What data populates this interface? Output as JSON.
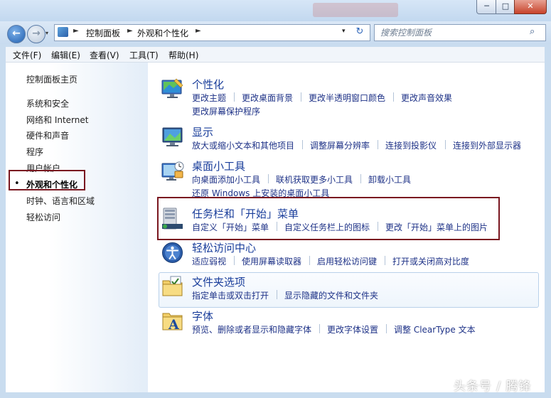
{
  "window": {
    "min_label": "─",
    "max_label": "□",
    "close_label": "✕"
  },
  "nav": {
    "back_icon": "arrow-left",
    "forward_icon": "arrow-right",
    "dropdown_glyph": "▾",
    "refresh_glyph": "↻"
  },
  "address": {
    "segments": [
      "控制面板",
      "外观和个性化"
    ],
    "chevron": "►"
  },
  "search": {
    "placeholder": "搜索控制面板"
  },
  "menu": [
    "文件(F)",
    "编辑(E)",
    "查看(V)",
    "工具(T)",
    "帮助(H)"
  ],
  "left_nav": {
    "items": [
      "控制面板主页",
      "系统和安全",
      "网络和 Internet",
      "硬件和声音",
      "程序",
      "用户帐户",
      "外观和个性化",
      "时钟、语言和区域",
      "轻松访问"
    ],
    "active_index": 6,
    "active_bullet": "•"
  },
  "categories": [
    {
      "title": "个性化",
      "icon": "personalization-icon",
      "links": [
        "更改主题",
        "更改桌面背景",
        "更改半透明窗口颜色",
        "更改声音效果",
        "更改屏幕保护程序"
      ]
    },
    {
      "title": "显示",
      "icon": "display-icon",
      "links": [
        "放大或缩小文本和其他项目",
        "调整屏幕分辨率",
        "连接到投影仪",
        "连接到外部显示器"
      ]
    },
    {
      "title": "桌面小工具",
      "icon": "gadgets-icon",
      "links": [
        "向桌面添加小工具",
        "联机获取更多小工具",
        "卸载小工具",
        "还原 Windows 上安装的桌面小工具"
      ]
    },
    {
      "title": "任务栏和「开始」菜单",
      "icon": "taskbar-icon",
      "links": [
        "自定义「开始」菜单",
        "自定义任务栏上的图标",
        "更改「开始」菜单上的图片"
      ]
    },
    {
      "title": "轻松访问中心",
      "icon": "ease-of-access-icon",
      "links": [
        "适应弱视",
        "使用屏幕读取器",
        "启用轻松访问键",
        "打开或关闭高对比度"
      ]
    },
    {
      "title": "文件夹选项",
      "icon": "folder-options-icon",
      "links": [
        "指定单击或双击打开",
        "显示隐藏的文件和文件夹"
      ]
    },
    {
      "title": "字体",
      "icon": "fonts-icon",
      "links": [
        "预览、删除或者显示和隐藏字体",
        "更改字体设置",
        "调整 ClearType 文本"
      ]
    }
  ],
  "watermark": "头条号 / 腾锋",
  "colors": {
    "link": "#1e3287",
    "title": "#1a3e9b",
    "highlight_box": "#7a1720",
    "frame": "#c9dcef"
  }
}
